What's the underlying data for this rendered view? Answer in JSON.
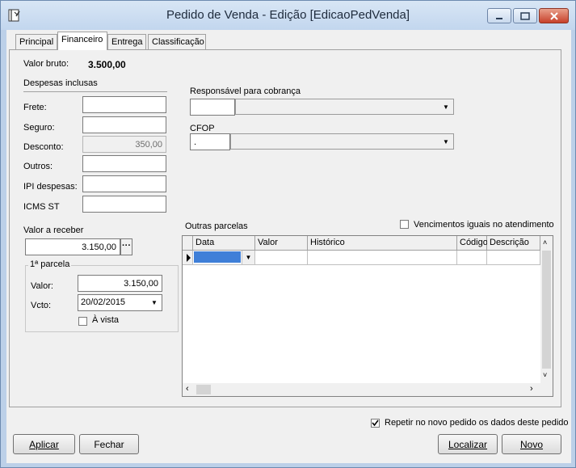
{
  "window": {
    "title": "Pedido de Venda - Edição [EdicaoPedVenda]"
  },
  "tabs": [
    {
      "label": "Principal"
    },
    {
      "label": "Financeiro"
    },
    {
      "label": "Entrega"
    },
    {
      "label": "Classificação"
    }
  ],
  "financeiro": {
    "valor_bruto_label": "Valor bruto:",
    "valor_bruto_value": "3.500,00",
    "despesas_title": "Despesas inclusas",
    "frete_label": "Frete:",
    "frete_value": "",
    "seguro_label": "Seguro:",
    "seguro_value": "",
    "desconto_label": "Desconto:",
    "desconto_value": "350,00",
    "outros_label": "Outros:",
    "outros_value": "",
    "ipi_label": "IPI despesas:",
    "ipi_value": "",
    "icms_label": "ICMS ST",
    "icms_value": "",
    "valor_receber_label": "Valor a receber",
    "valor_receber_value": "3.150,00",
    "ellipsis": "···",
    "parcela_title": "1ª parcela",
    "valor_label": "Valor:",
    "valor_value": "3.150,00",
    "vcto_label": "Vcto:",
    "vcto_value": "20/02/2015",
    "avista_label": "À vista",
    "responsavel_label": "Responsável para cobrança",
    "responsavel_code": "",
    "responsavel_name": "",
    "cfop_label": "CFOP",
    "cfop_code": ".",
    "cfop_name": "",
    "outras_parcelas_label": "Outras parcelas",
    "vencimentos_label": "Vencimentos iguais no atendimento",
    "grid_columns": [
      "Data",
      "Valor",
      "Histórico",
      "Código",
      "Descrição"
    ]
  },
  "footer": {
    "repetir_label": "Repetir no novo pedido os dados deste pedido",
    "aplicar": "Aplicar",
    "fechar": "Fechar",
    "localizar": "Localizar",
    "novo": "Novo"
  },
  "colors": {
    "grid_selection": "#3f7fd8",
    "title_bar": "#c2d6ee"
  }
}
